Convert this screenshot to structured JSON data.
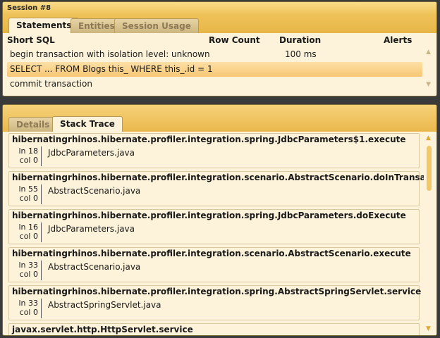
{
  "session": {
    "title": "Session #8"
  },
  "top_tabs": [
    {
      "label": "Statements",
      "active": true
    },
    {
      "label": "Entities",
      "active": false
    },
    {
      "label": "Session Usage",
      "active": false
    }
  ],
  "statements": {
    "columns": [
      "Short SQL",
      "Row Count",
      "Duration",
      "Alerts"
    ],
    "rows": [
      {
        "sql": "begin transaction with isolation level: unknown",
        "row_count": "",
        "duration": "100 ms",
        "alerts": "",
        "selected": false
      },
      {
        "sql": "SELECT ... FROM Blogs this_ WHERE this_.id = 1",
        "row_count": "",
        "duration": "",
        "alerts": "",
        "selected": true
      },
      {
        "sql": "commit transaction",
        "row_count": "",
        "duration": "",
        "alerts": "",
        "selected": false
      }
    ]
  },
  "bottom_tabs": [
    {
      "label": "Details",
      "active": false
    },
    {
      "label": "Stack Trace",
      "active": true
    }
  ],
  "stack_trace": [
    {
      "method": "hibernatingrhinos.hibernate.profiler.integration.spring.JdbcParameters$1.execute",
      "ln": "ln 18",
      "col": "col 0",
      "file": "JdbcParameters.java"
    },
    {
      "method": "hibernatingrhinos.hibernate.profiler.integration.scenario.AbstractScenario.doInTransaction",
      "ln": "ln 55",
      "col": "col 0",
      "file": "AbstractScenario.java"
    },
    {
      "method": "hibernatingrhinos.hibernate.profiler.integration.spring.JdbcParameters.doExecute",
      "ln": "ln 16",
      "col": "col 0",
      "file": "JdbcParameters.java"
    },
    {
      "method": "hibernatingrhinos.hibernate.profiler.integration.scenario.AbstractScenario.execute",
      "ln": "ln 33",
      "col": "col 0",
      "file": "AbstractScenario.java"
    },
    {
      "method": "hibernatingrhinos.hibernate.profiler.integration.spring.AbstractSpringServlet.service",
      "ln": "ln 33",
      "col": "col 0",
      "file": "AbstractSpringServlet.java"
    },
    {
      "method": "javax.servlet.http.HttpServlet.service",
      "ln": "",
      "col": "",
      "file": ""
    }
  ],
  "icons": {
    "scroll_up": "triangle-up-icon",
    "scroll_down": "triangle-down-icon"
  },
  "colors": {
    "header": "#efc258",
    "panel_bg": "#fdf3da",
    "selected_row": "#f7c774",
    "scroll_thumb": "#f1c768"
  }
}
